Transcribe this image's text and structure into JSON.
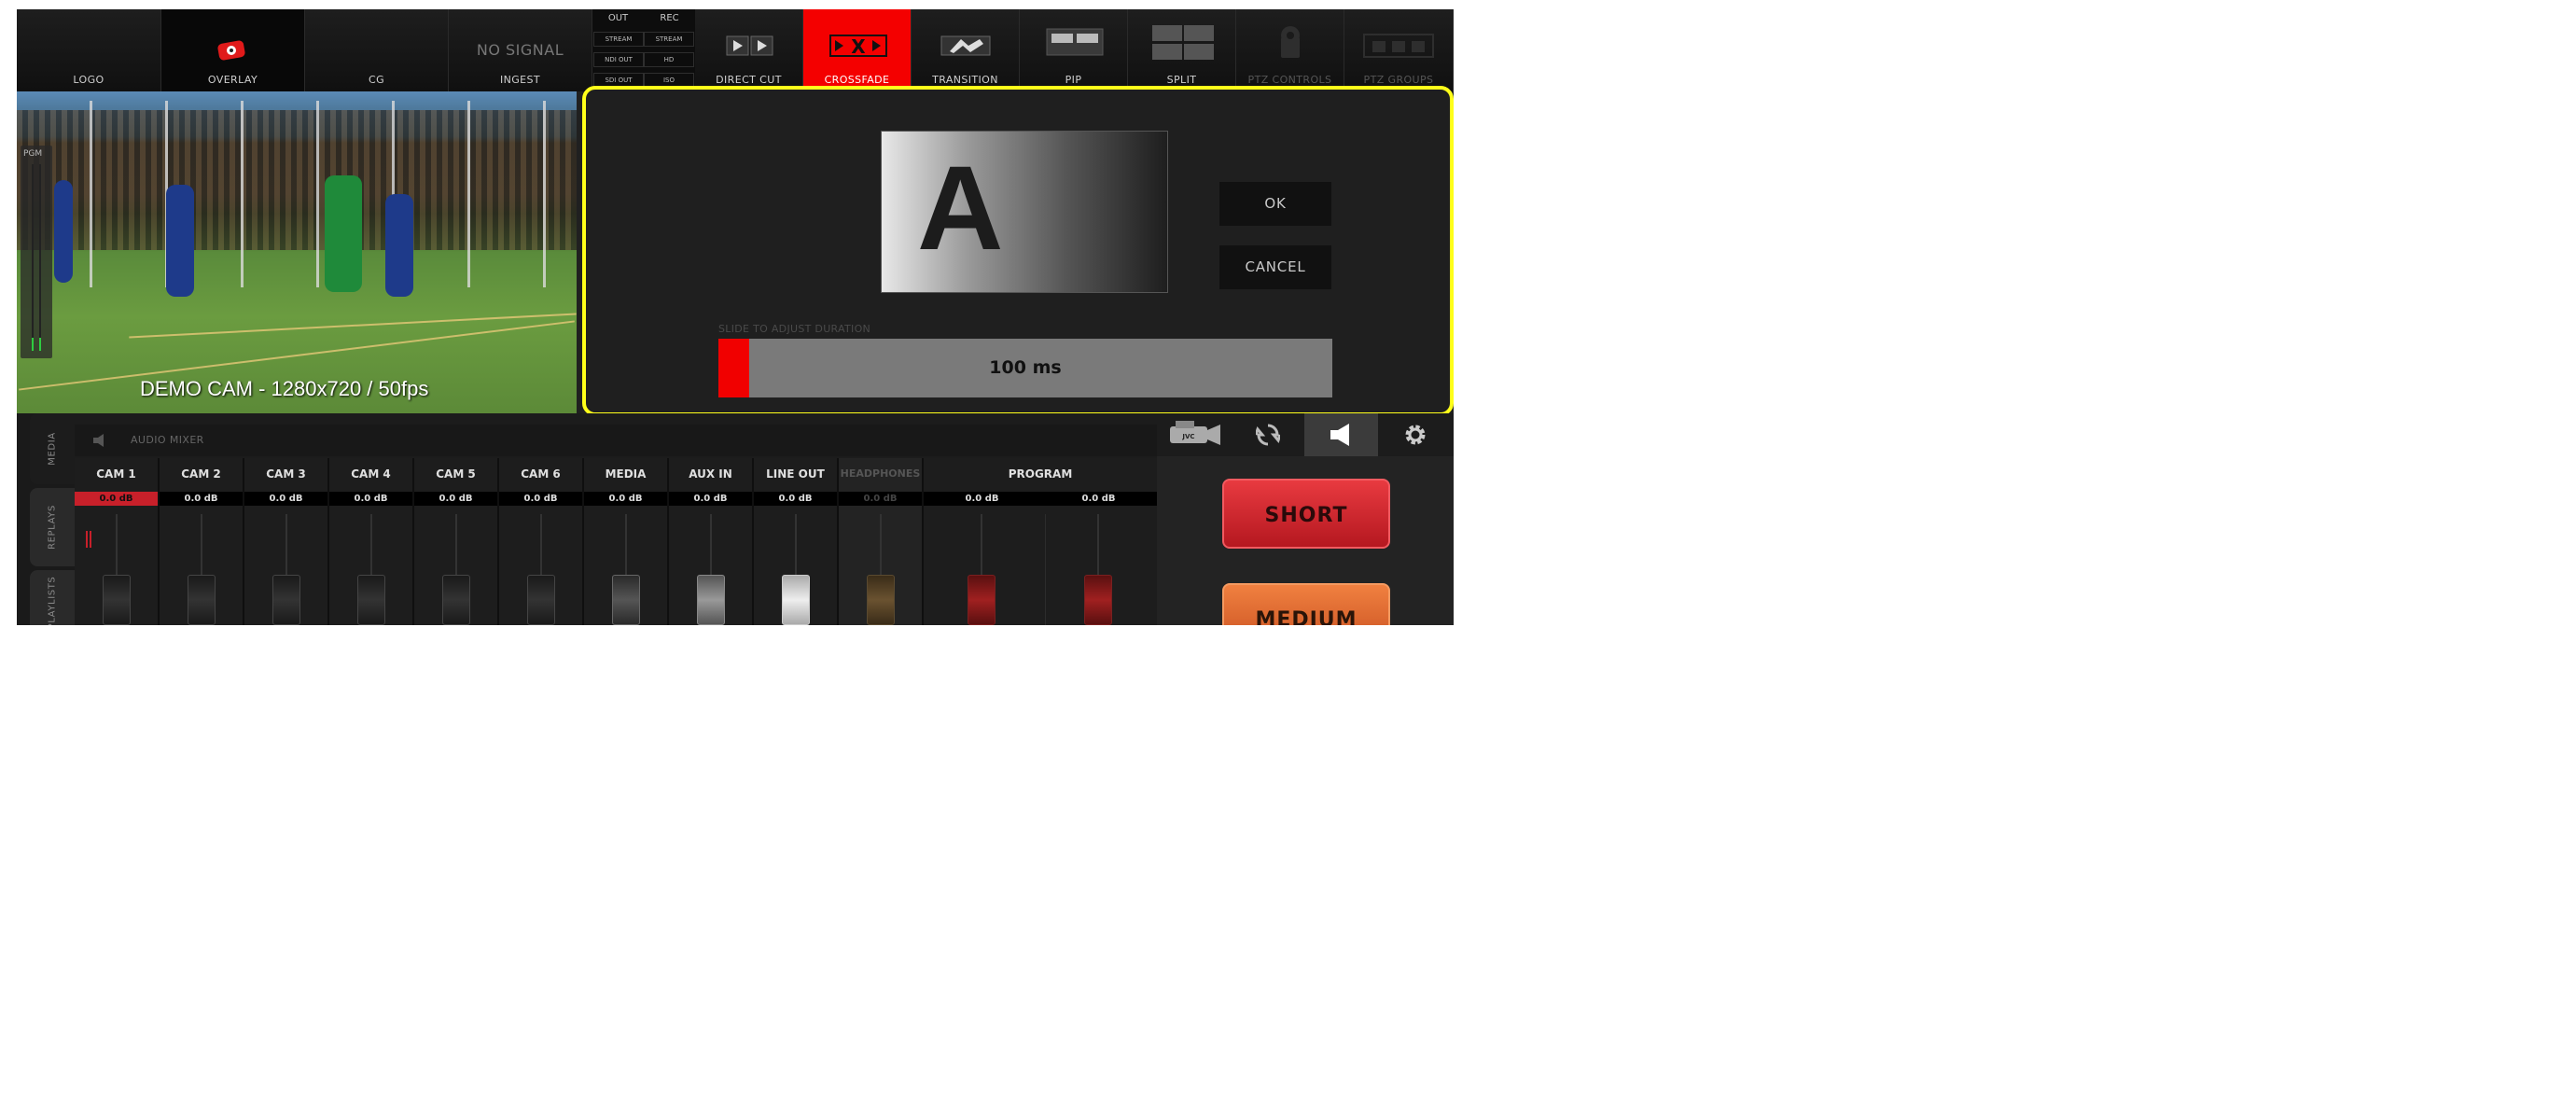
{
  "top_bar": {
    "buttons": [
      {
        "label": "LOGO"
      },
      {
        "label": "OVERLAY"
      },
      {
        "label": "CG"
      },
      {
        "label": "INGEST",
        "status": "NO SIGNAL"
      },
      {
        "label": "DIRECT CUT"
      },
      {
        "label": "CROSSFADE",
        "active": true
      },
      {
        "label": "TRANSITION"
      },
      {
        "label": "PIP"
      },
      {
        "label": "SPLIT"
      },
      {
        "label": "PTZ CONTROLS"
      },
      {
        "label": "PTZ GROUPS"
      }
    ],
    "output_grid": {
      "headers": [
        "OUT",
        "REC"
      ],
      "cells": [
        "STREAM",
        "STREAM",
        "NDI OUT",
        "HD",
        "SDI OUT",
        "ISO"
      ]
    }
  },
  "preview": {
    "caption": "DEMO CAM - 1280x720 / 50fps",
    "meter_label": "PGM"
  },
  "dialog": {
    "preview_letter": "A",
    "ok_label": "OK",
    "cancel_label": "CANCEL",
    "slider_label": "SLIDE TO ADJUST DURATION",
    "duration_value": "100  ms",
    "duration_fraction": 0.05,
    "border_color": "#ffff1a",
    "accent_color": "#f10000"
  },
  "side_tabs": [
    "MEDIA",
    "REPLAYS",
    "PLAYLISTS"
  ],
  "audio_mixer": {
    "title": "AUDIO MIXER",
    "channels": [
      {
        "name": "CAM 1",
        "db": "0.0 dB"
      },
      {
        "name": "CAM 2",
        "db": "0.0 dB"
      },
      {
        "name": "CAM 3",
        "db": "0.0 dB"
      },
      {
        "name": "CAM 4",
        "db": "0.0 dB"
      },
      {
        "name": "CAM 5",
        "db": "0.0 dB"
      },
      {
        "name": "CAM 6",
        "db": "0.0 dB"
      },
      {
        "name": "MEDIA",
        "db": "0.0 dB"
      },
      {
        "name": "AUX IN",
        "db": "0.0 dB"
      },
      {
        "name": "LINE OUT",
        "db": "0.0 dB"
      },
      {
        "name": "HEADPHONES",
        "db": "0.0 dB"
      }
    ],
    "program": {
      "name": "PROGRAM",
      "db_left": "0.0 dB",
      "db_right": "0.0 dB"
    }
  },
  "right_panel": {
    "icons": [
      "jvc-camera-icon",
      "refresh-icon",
      "speaker-icon",
      "gear-icon"
    ],
    "short_label": "SHORT",
    "medium_label": "MEDIUM",
    "short_color": "#d8202a",
    "medium_color": "#e8672a"
  }
}
